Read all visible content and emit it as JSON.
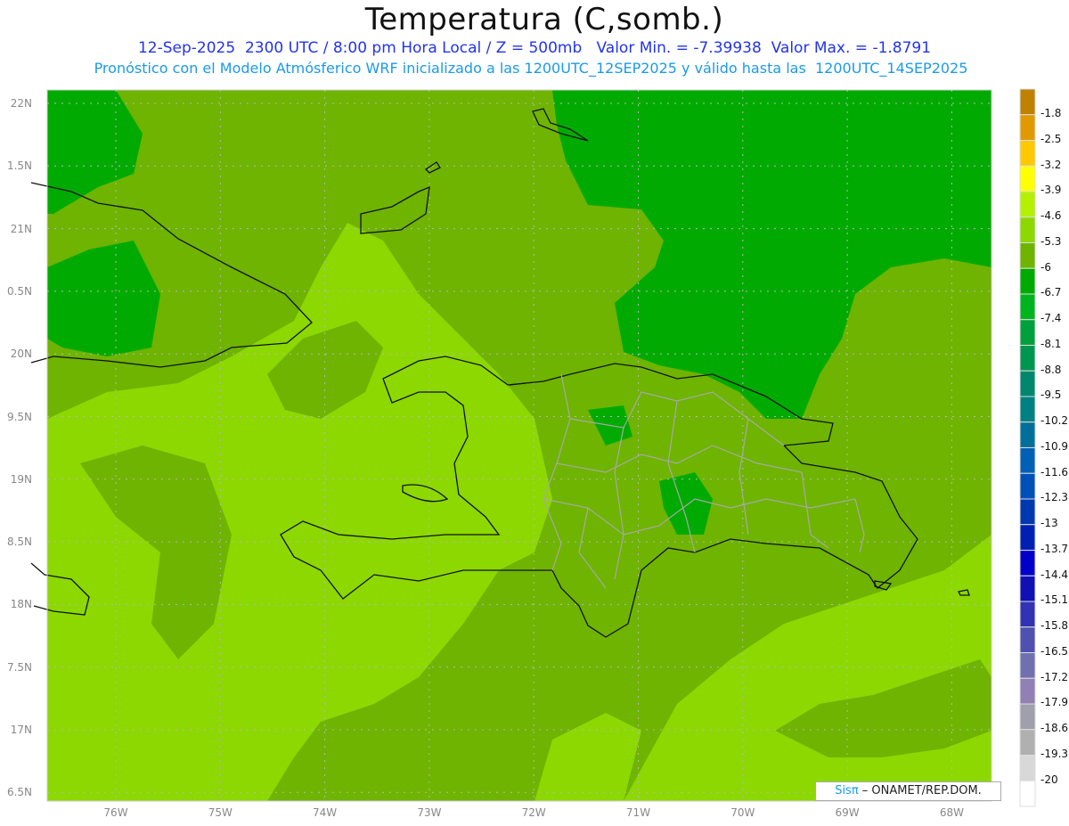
{
  "title": "Temperatura (C,somb.)",
  "subtitle_line1": "12-Sep-2025  2300 UTC / 8:00 pm Hora Local / Z = 500mb   Valor Min. = -7.39938  Valor Max. = -1.8791",
  "subtitle_line2": "Pronóstico con el Modelo Atmósferico WRF inicializado a las 1200UTC_12SEP2025 y válido hasta las  1200UTC_14SEP2025",
  "lat_labels": [
    "22N",
    "1.5N",
    "21N",
    "0.5N",
    "20N",
    "9.5N",
    "19N",
    "8.5N",
    "18N",
    "7.5N",
    "17N",
    "6.5N"
  ],
  "lon_labels": [
    "76W",
    "75W",
    "74W",
    "73W",
    "72W",
    "71W",
    "70W",
    "69W",
    "68W"
  ],
  "colorbar": {
    "labels": [
      "-1.8",
      "-2.5",
      "-3.2",
      "-3.9",
      "-4.6",
      "-5.3",
      "-6",
      "-6.7",
      "-7.4",
      "-8.1",
      "-8.8",
      "-9.5",
      "-10.2",
      "-10.9",
      "-11.6",
      "-12.3",
      "-13",
      "-13.7",
      "-14.4",
      "-15.1",
      "-15.8",
      "-16.5",
      "-17.2",
      "-17.9",
      "-18.6",
      "-19.3",
      "-20"
    ],
    "colors": [
      "#c08000",
      "#e09a00",
      "#ffc800",
      "#ffff00",
      "#b4f000",
      "#8cd800",
      "#6eb400",
      "#00aa00",
      "#00b41e",
      "#00a03c",
      "#009650",
      "#00876e",
      "#008080",
      "#00709a",
      "#0060b4",
      "#0050b8",
      "#0038b0",
      "#0020b4",
      "#0000c8",
      "#1010b4",
      "#3232b4",
      "#5050b0",
      "#7070b0",
      "#9080b4",
      "#a0a0ac",
      "#b0b0b0",
      "#d8d8d8",
      "#ffffff"
    ]
  },
  "watermark": {
    "brand": "Sisπ",
    "text": " – ONAMET/REP.DOM."
  },
  "fill_colors": {
    "light": "#8cd800",
    "mid": "#6eb400",
    "dark": "#00aa00"
  }
}
